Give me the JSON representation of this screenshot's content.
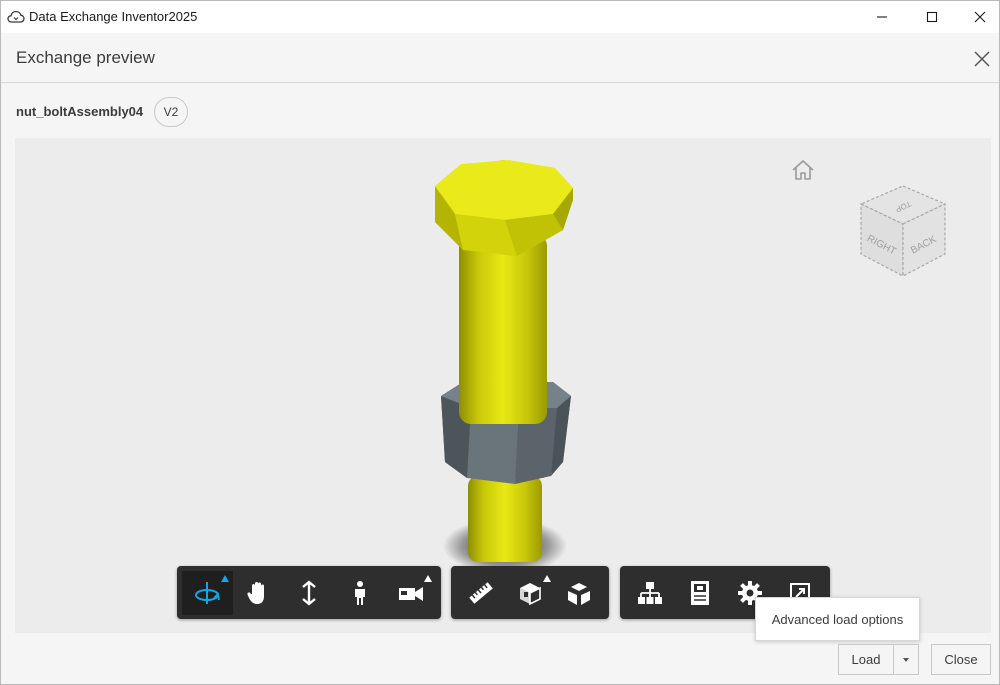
{
  "window": {
    "title": "Data Exchange Inventor2025",
    "icon": "cloud-exchange-icon"
  },
  "dialog": {
    "title": "Exchange preview"
  },
  "asset": {
    "name": "nut_boltAssembly04",
    "version": "V2"
  },
  "viewcube": {
    "faces": [
      "TOP",
      "RIGHT",
      "BACK"
    ]
  },
  "colors": {
    "bolt": "#e2e20c",
    "nut": "#5f6a70",
    "toolbar": "#2e2e2e",
    "active_tool": "#18a3e2",
    "viewer_bg": "#ececec"
  },
  "toolbar": {
    "navigation": [
      "orbit-icon",
      "pan-icon",
      "dolly-icon",
      "first-person-icon",
      "camera-icon"
    ],
    "tools": [
      "measure-icon",
      "section-analysis-icon",
      "explode-model-icon"
    ],
    "panels": [
      "model-browser-icon",
      "properties-icon",
      "settings-icon",
      "fullscreen-icon"
    ]
  },
  "tooltip": {
    "text": "Advanced load options"
  },
  "footer": {
    "load_label": "Load",
    "close_label": "Close"
  }
}
